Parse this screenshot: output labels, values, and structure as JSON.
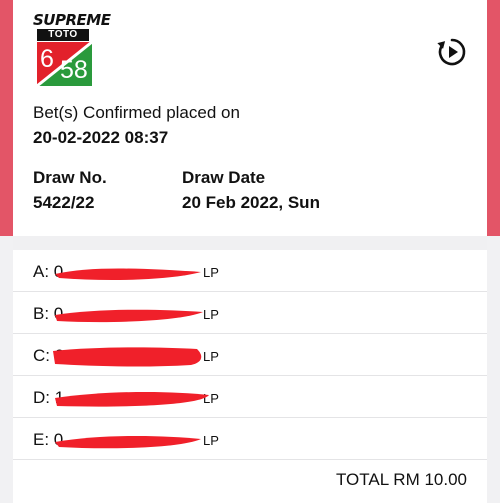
{
  "logo": {
    "brand": "SUPREME",
    "sub": "TOTO",
    "num_a": "6",
    "num_b": "58",
    "colors": {
      "red": "#e2212b",
      "green": "#2a9a3c"
    }
  },
  "header": {
    "replay_icon": "replay-icon"
  },
  "confirmation": {
    "label": "Bet(s) Confirmed placed on",
    "datetime": "20-02-2022 08:37"
  },
  "draw": {
    "no_label": "Draw No.",
    "no_value": "5422/22",
    "date_label": "Draw Date",
    "date_value": "20 Feb 2022, Sun"
  },
  "bets": [
    {
      "letter": "A: 0",
      "type": "LP"
    },
    {
      "letter": "B: 0",
      "type": "LP"
    },
    {
      "letter": "C: 0",
      "type": "LP"
    },
    {
      "letter": "D: 1",
      "type": "LP"
    },
    {
      "letter": "E: 0",
      "type": "LP"
    }
  ],
  "total": "TOTAL RM 10.00",
  "accent_color": "#e35567",
  "redaction_color": "#f0202a"
}
